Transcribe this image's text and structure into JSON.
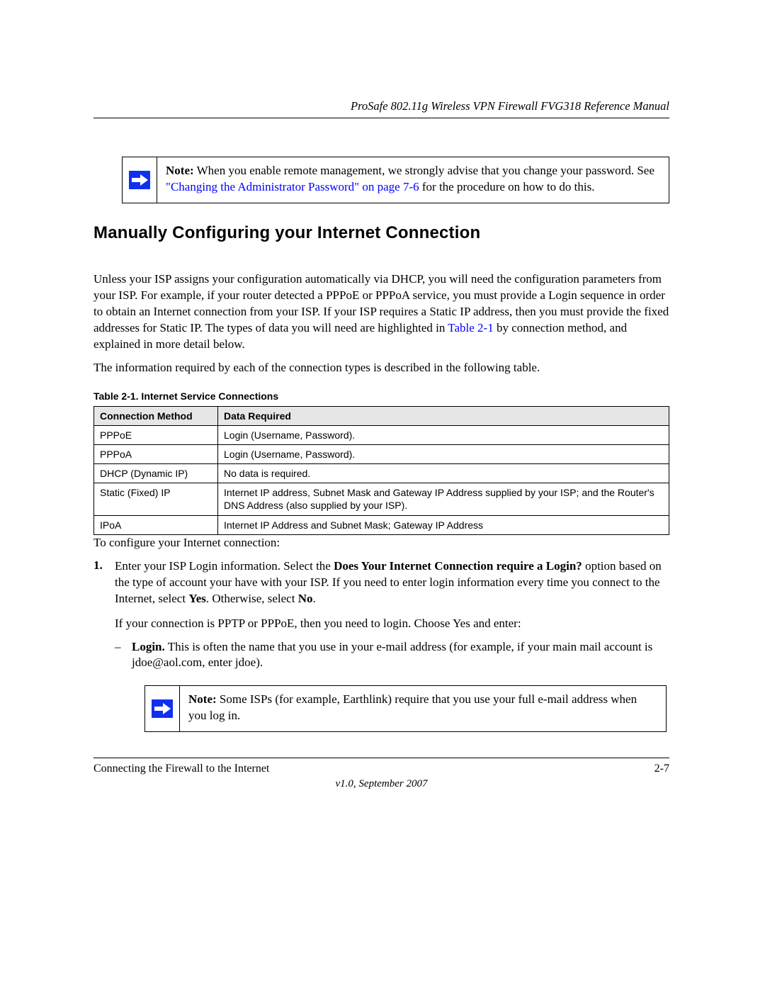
{
  "header": {
    "title": "ProSafe 802.11g Wireless VPN Firewall FVG318 Reference Manual"
  },
  "note1": {
    "label": "Note:",
    "text_before_link": " When you enable remote management, we strongly advise that you change your password. See ",
    "link": "\"Changing the Administrator Password\" on page 7-6",
    "text_after_link": " for the procedure on how to do this."
  },
  "heading": "Manually Configuring your Internet Connection",
  "para1": {
    "before_link": "Unless your ISP assigns your configuration automatically via DHCP, you will need the configuration parameters from your ISP. For example, if your router detected a PPPoE or PPPoA service, you must provide a Login sequence in order to obtain an Internet connection from your ISP. If your ISP requires a Static IP address, then you must provide the fixed addresses for Static IP. The types of data you will need are highlighted in ",
    "link": "Table 2-1",
    "after_link": " by connection method, and explained in more detail below."
  },
  "para2": "The information required by each of the connection types is described in the following table.",
  "table": {
    "caption": "Table 2-1.  Internet Service Connections",
    "headers": [
      "Connection Method",
      "Data Required"
    ],
    "rows": [
      {
        "method": "PPPoE",
        "data": "Login (Username, Password)."
      },
      {
        "method": "PPPoA",
        "data": "Login (Username, Password)."
      },
      {
        "method": "DHCP (Dynamic IP)",
        "data": "No data is required."
      },
      {
        "method": "Static (Fixed) IP",
        "data": "Internet IP address, Subnet Mask and Gateway IP Address supplied by your ISP; and the Router's DNS Address (also supplied by your ISP)."
      },
      {
        "method": "IPoA",
        "data": "Internet IP Address and Subnet Mask; Gateway IP Address"
      }
    ]
  },
  "intro_line": "To configure your Internet connection:",
  "step1": {
    "num": "1.",
    "t1": "Enter your ISP Login information. Select the ",
    "bold1": "Does Your Internet Connection require a Login?",
    "t2": " option based on the type of account your have with your ISP. If you need to enter login information every time you connect to the Internet, select ",
    "bold2": "Yes",
    "t3": ". Otherwise, select ",
    "bold3": "No",
    "t4": "."
  },
  "step1_extra": "If your connection is PPTP or PPPoE, then you need to login. Choose Yes and enter:",
  "bullet1": {
    "label": "Login.",
    "text": " This is often the name that you use in your e-mail address (for example, if your main mail account is jdoe@aol.com, enter jdoe)."
  },
  "note2": {
    "label": "Note:",
    "text": " Some ISPs (for example, Earthlink) require that you use your full e-mail address when you log in."
  },
  "footer": {
    "left": "Connecting the Firewall to the Internet",
    "right": "2-7",
    "version": "v1.0, September 2007"
  }
}
